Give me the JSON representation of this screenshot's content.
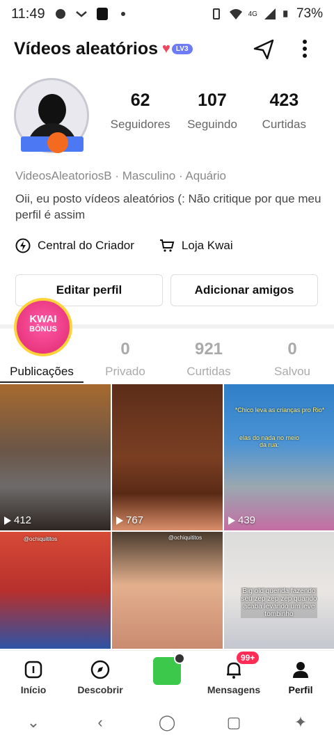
{
  "status_bar": {
    "time": "11:49",
    "network": "4G",
    "battery": "73%"
  },
  "header": {
    "title": "Vídeos aleatórios",
    "level_badge": "LV3"
  },
  "profile": {
    "stats": [
      {
        "value": "62",
        "label": "Seguidores"
      },
      {
        "value": "107",
        "label": "Seguindo"
      },
      {
        "value": "423",
        "label": "Curtidas"
      }
    ],
    "meta": "VideosAleatoriosB · Masculino · Aquário",
    "bio": "Oii, eu posto vídeos aleatórios (: Não critique por que meu perfil é assim",
    "links": {
      "creator_center": "Central do Criador",
      "shop": "Loja Kwai"
    },
    "buttons": {
      "edit": "Editar perfil",
      "add_friends": "Adicionar amigos"
    },
    "kwai_bonus": {
      "line1": "KWAI",
      "line2": "BÔNUS"
    }
  },
  "tabs": [
    {
      "count": "",
      "label": "Publicações"
    },
    {
      "count": "0",
      "label": "Privado"
    },
    {
      "count": "921",
      "label": "Curtidas"
    },
    {
      "count": "0",
      "label": "Salvou"
    }
  ],
  "videos": [
    {
      "views": "412"
    },
    {
      "views": "767"
    },
    {
      "views": "439",
      "caption1": "*Chico leva as crianças pro Rio*",
      "caption2": "elas do nada no meio da rua:"
    },
    {
      "caption": "@ochiquititos"
    },
    {
      "caption": "@ochiquititos"
    },
    {
      "caption": "Big old querida fazendo seu zep zep zep quando acaba levando um leve tombinho"
    }
  ],
  "bottom_nav": {
    "items": [
      "Início",
      "Descobrir",
      "",
      "Mensagens",
      "Perfil"
    ],
    "messages_badge": "99+"
  },
  "colors": {
    "accent": "#ff2d55",
    "create_button": "#3cc84a"
  }
}
